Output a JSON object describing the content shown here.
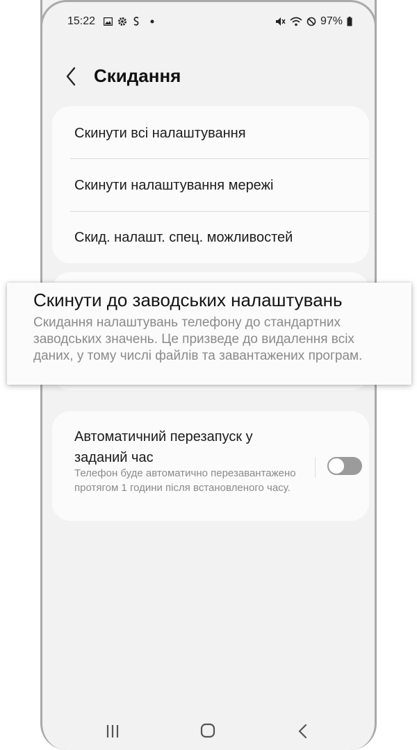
{
  "status_bar": {
    "time": "15:22",
    "battery": "97%",
    "icons": [
      "image-icon",
      "gear-icon",
      "s-icon",
      "dot-icon",
      "mute-icon",
      "wifi-icon",
      "block-icon",
      "battery-icon"
    ]
  },
  "header": {
    "title": "Скидання"
  },
  "reset_list": {
    "items": [
      {
        "label": "Скинути всі налаштування"
      },
      {
        "label": "Скинути налаштування мережі"
      },
      {
        "label": "Скид. налашт. спец. можливостей"
      }
    ]
  },
  "factory_reset": {
    "title": "Скинути до заводських налаштувань",
    "description": "Скидання налаштувань телефону до стандартних заводських значень. Це призведе до видалення всіх даних, у тому числі файлів та завантажених програм."
  },
  "auto_restart": {
    "title": "Автоматичний перезапуск у заданий час",
    "description": "Телефон буде автоматично перезавантажено протягом 1 години після встановленого часу.",
    "enabled": false
  },
  "nav_bar": {
    "buttons": [
      "recents-icon",
      "home-icon",
      "back-nav-icon"
    ]
  },
  "colors": {
    "background": "#f2f2f2",
    "card": "#fbfbfb",
    "text_primary": "#1b1b1b",
    "text_secondary": "#8a8a8a",
    "toggle_off": "#9b9b9b",
    "frame": "#a9a9a9"
  }
}
